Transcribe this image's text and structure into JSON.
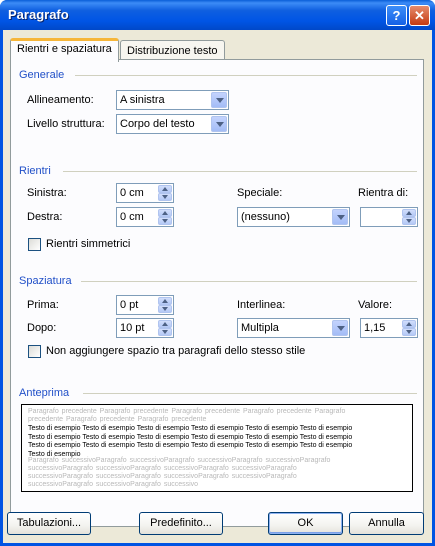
{
  "window": {
    "title": "Paragrafo",
    "help_label": "?",
    "close_label": "✕"
  },
  "tabs": [
    {
      "label": "Rientri e spaziatura",
      "active": true
    },
    {
      "label": "Distribuzione testo",
      "active": false
    }
  ],
  "generale": {
    "heading": "Generale",
    "allineamento_label": "Allineamento:",
    "allineamento_value": "A sinistra",
    "livello_label": "Livello struttura:",
    "livello_value": "Corpo del testo"
  },
  "rientri": {
    "heading": "Rientri",
    "sinistra_label": "Sinistra:",
    "sinistra_value": "0 cm",
    "destra_label": "Destra:",
    "destra_value": "0 cm",
    "speciale_label": "Speciale:",
    "speciale_value": "(nessuno)",
    "rientra_di_label": "Rientra di:",
    "rientra_di_value": "",
    "simmetrici_label": "Rientri simmetrici",
    "simmetrici_checked": false
  },
  "spaziatura": {
    "heading": "Spaziatura",
    "prima_label": "Prima:",
    "prima_value": "0 pt",
    "dopo_label": "Dopo:",
    "dopo_value": "10 pt",
    "interlinea_label": "Interlinea:",
    "interlinea_value": "Multipla",
    "valore_label": "Valore:",
    "valore_value": "1,15",
    "no_space_label": "Non aggiungere spazio tra paragrafi dello stesso stile",
    "no_space_checked": false
  },
  "anteprima": {
    "heading": "Anteprima",
    "prev_text": "Paragrafo precedente Paragrafo precedente Paragrafo precedente Paragrafo precedente Paragrafo precedente Paragrafo precedente Paragrafo precedente",
    "sample_text": "Testo di esempio Testo di esempio Testo di esempio Testo di esempio Testo di esempio Testo di esempio Testo di esempio Testo di esempio Testo di esempio Testo di esempio Testo di esempio Testo di esempio Testo di esempio Testo di esempio Testo di esempio Testo di esempio Testo di esempio Testo di esempio Testo di esempio",
    "next_text": "Paragrafo successivoParagrafo successivoParagrafo successivoParagrafo successivoParagrafo successivoParagrafo successivoParagrafo successivoParagrafo successivoParagrafo successivoParagrafo successivoParagrafo successivoParagrafo successivoParagrafo successivoParagrafo successivoParagrafo successivo"
  },
  "buttons": {
    "tabulazioni": "Tabulazioni...",
    "predefinito": "Predefinito...",
    "ok": "OK",
    "annulla": "Annulla"
  },
  "colors": {
    "titlebar": "#0054e3",
    "group_heading": "#2150c8",
    "dialog_bg": "#ece9d8"
  }
}
